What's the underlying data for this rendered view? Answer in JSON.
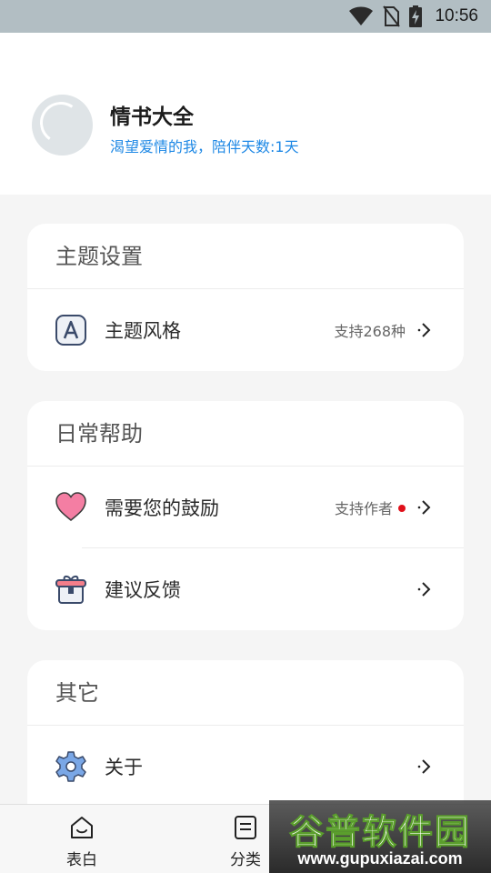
{
  "status_bar": {
    "time": "10:56",
    "icons": [
      "wifi-icon",
      "no-sim-icon",
      "battery-charging-icon"
    ]
  },
  "profile": {
    "app_name": "情书大全",
    "tagline": "渴望爱情的我，陪伴天数:1天"
  },
  "sections": {
    "theme": {
      "title": "主题设置",
      "items": [
        {
          "icon": "theme-a-icon",
          "label": "主题风格",
          "extra": "支持268种"
        }
      ]
    },
    "help": {
      "title": "日常帮助",
      "items": [
        {
          "icon": "heart-icon",
          "label": "需要您的鼓励",
          "extra": "支持作者"
        },
        {
          "icon": "gift-icon",
          "label": "建议反馈",
          "extra": ""
        }
      ]
    },
    "other": {
      "title": "其它",
      "items": [
        {
          "icon": "gear-icon",
          "label": "关于",
          "extra": ""
        }
      ]
    }
  },
  "bottom_nav": [
    {
      "icon": "home-icon",
      "label": "表白"
    },
    {
      "icon": "list-icon",
      "label": "分类"
    }
  ],
  "watermark": {
    "main": "谷普软件园",
    "sub": "www.gupuxiazai.com"
  },
  "colors": {
    "accent_blue": "#1e88e5",
    "status_bar": "#b2bec3",
    "heart_pink": "#f47ea3",
    "gear_blue": "#7aa7e6"
  }
}
